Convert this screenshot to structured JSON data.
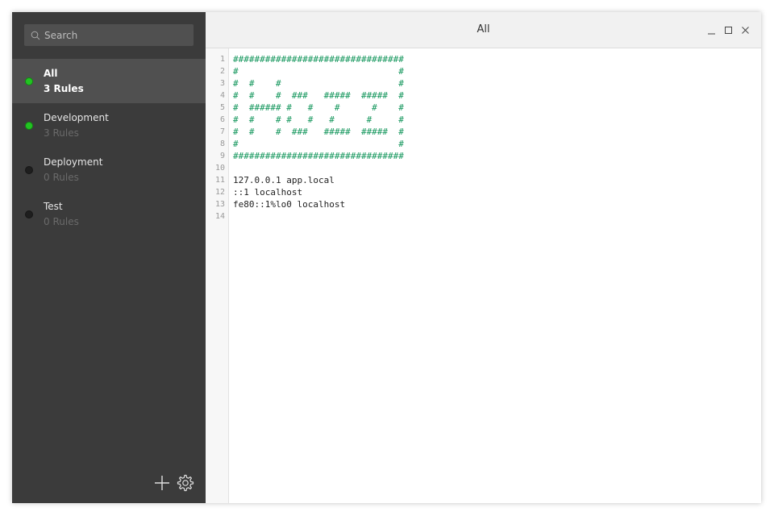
{
  "window": {
    "title": "All"
  },
  "search": {
    "placeholder": "Search",
    "value": ""
  },
  "groups": [
    {
      "name": "All",
      "count": "3 Rules",
      "enabled": true,
      "active": true
    },
    {
      "name": "Development",
      "count": "3 Rules",
      "enabled": true,
      "active": false
    },
    {
      "name": "Deployment",
      "count": "0 Rules",
      "enabled": false,
      "active": false
    },
    {
      "name": "Test",
      "count": "0 Rules",
      "enabled": false,
      "active": false
    }
  ],
  "editor": {
    "lines": [
      "################################",
      "#                              #",
      "#  #    #                      #",
      "#  #    #  ###   #####  #####  #",
      "#  ###### #   #    #      #    #",
      "#  #    # #   #   #      #     #",
      "#  #    #  ###   #####  #####  #",
      "#                              #",
      "################################",
      "",
      "127.0.0.1 app.local",
      "::1 localhost",
      "fe80::1%lo0 localhost",
      ""
    ]
  },
  "colors": {
    "sidebar_bg": "#3b3b3b",
    "active_bg": "#505050",
    "enabled_dot": "#22c322",
    "disabled_dot": "#1e1e1e",
    "comment_text": "#11955a"
  },
  "icons": {
    "search": "search-icon",
    "add": "plus-icon",
    "settings": "gear-icon",
    "minimize": "minimize-icon",
    "maximize": "maximize-icon",
    "close": "close-icon"
  }
}
